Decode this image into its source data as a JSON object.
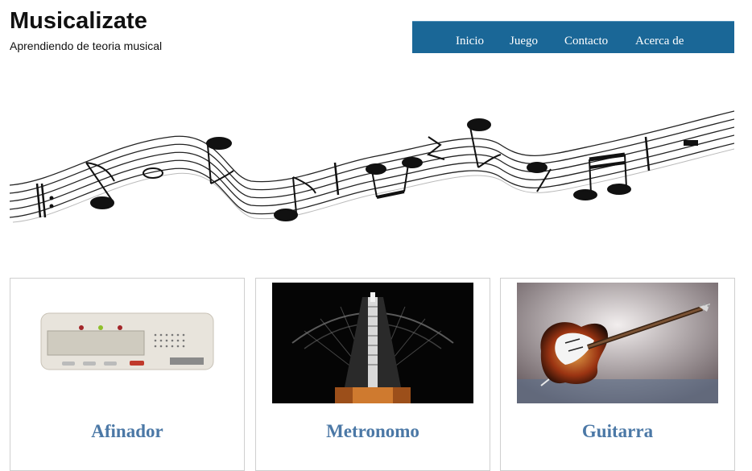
{
  "header": {
    "title": "Musicalizate",
    "subtitle": "Aprendiendo de teoria musical"
  },
  "nav": {
    "items": [
      {
        "label": "Inicio"
      },
      {
        "label": "Juego"
      },
      {
        "label": "Contacto"
      },
      {
        "label": "Acerca de"
      }
    ],
    "background": "#1a6797"
  },
  "hero": {
    "image": "music-staff-with-notes"
  },
  "cards": [
    {
      "title": "Afinador",
      "image": "tuner-photo"
    },
    {
      "title": "Metronomo",
      "image": "metronome-photo"
    },
    {
      "title": "Guitarra",
      "image": "guitar-photo"
    }
  ],
  "colors": {
    "card_title": "#4b78a6",
    "nav_text": "#ffffff"
  }
}
